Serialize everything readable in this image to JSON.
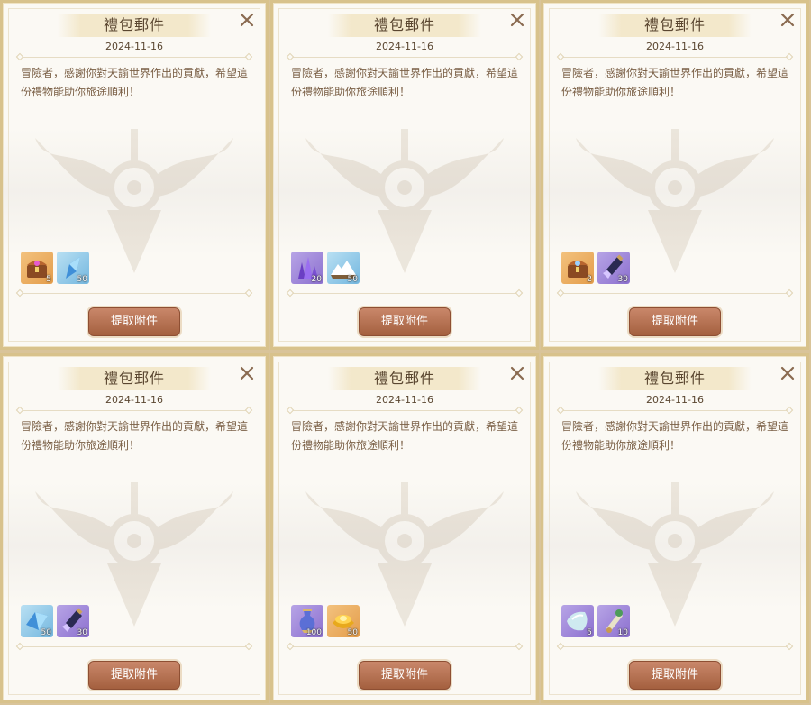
{
  "mails": [
    {
      "title": "禮包郵件",
      "date": "2024-11-16",
      "body": "冒險者，感謝你對天諭世界作出的貢獻，希望這份禮物能助你旅途順利！",
      "claim_label": "提取附件",
      "items": [
        {
          "icon": "treasure-chest-icon",
          "qty": "5",
          "bg": "orange"
        },
        {
          "icon": "blue-crystal-icon",
          "qty": "50",
          "bg": "blue"
        }
      ]
    },
    {
      "title": "禮包郵件",
      "date": "2024-11-16",
      "body": "冒險者，感謝你對天諭世界作出的貢獻，希望這份禮物能助你旅途順利！",
      "claim_label": "提取附件",
      "items": [
        {
          "icon": "purple-crystal-cluster-icon",
          "qty": "20",
          "bg": "purple"
        },
        {
          "icon": "snowy-mountain-scroll-icon",
          "qty": "50",
          "bg": "blue"
        }
      ]
    },
    {
      "title": "禮包郵件",
      "date": "2024-11-16",
      "body": "冒險者，感謝你對天諭世界作出的貢獻，希望這份禮物能助你旅途順利！",
      "claim_label": "提取附件",
      "items": [
        {
          "icon": "treasure-chest-icon",
          "qty": "2",
          "bg": "orange"
        },
        {
          "icon": "potion-vial-icon",
          "qty": "30",
          "bg": "purple"
        }
      ]
    },
    {
      "title": "禮包郵件",
      "date": "2024-11-16",
      "body": "冒險者，感謝你對天諭世界作出的貢獻，希望這份禮物能助你旅途順利！",
      "claim_label": "提取附件",
      "items": [
        {
          "icon": "blue-crystal-icon",
          "qty": "50",
          "bg": "blue"
        },
        {
          "icon": "potion-vial-icon",
          "qty": "30",
          "bg": "purple"
        }
      ]
    },
    {
      "title": "禮包郵件",
      "date": "2024-11-16",
      "body": "冒險者，感謝你對天諭世界作出的貢獻，希望這份禮物能助你旅途順利！",
      "claim_label": "提取附件",
      "items": [
        {
          "icon": "purple-vase-icon",
          "qty": "100",
          "bg": "purple"
        },
        {
          "icon": "gold-ingot-icon",
          "qty": "50",
          "bg": "orange"
        }
      ]
    },
    {
      "title": "禮包郵件",
      "date": "2024-11-16",
      "body": "冒險者，感謝你對天諭世界作出的貢獻，希望這份禮物能助你旅途順利！",
      "claim_label": "提取附件",
      "items": [
        {
          "icon": "pale-gem-icon",
          "qty": "5",
          "bg": "purple"
        },
        {
          "icon": "scroll-icon",
          "qty": "10",
          "bg": "purple"
        }
      ]
    }
  ],
  "colors": {
    "frame": "#d8c28c",
    "button": "#a4603f",
    "text": "#7a5f45"
  }
}
